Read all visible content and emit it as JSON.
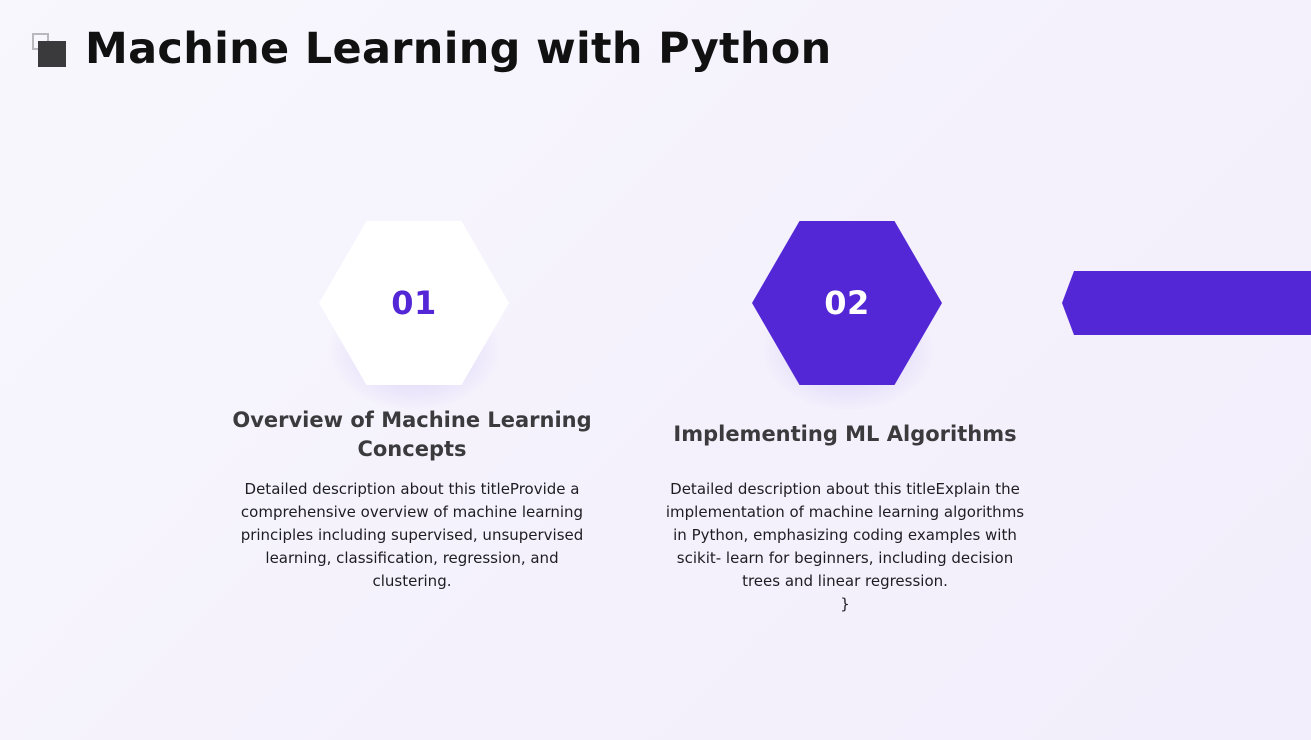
{
  "header": {
    "title": "Machine Learning with Python"
  },
  "items": [
    {
      "number": "01",
      "title_lines": [
        "Overview of Machine Learning",
        "Concepts"
      ],
      "description_lines": [
        "Detailed description about this titleProvide a",
        "comprehensive overview of machine learning",
        "principles including supervised, unsupervised",
        "learning, classification, regression, and",
        "clustering."
      ]
    },
    {
      "number": "02",
      "title_lines": [
        "Implementing ML Algorithms"
      ],
      "description_lines": [
        "Detailed description about this titleExplain the",
        "implementation of machine learning algorithms",
        "in Python, emphasizing coding examples with",
        "scikit- learn for beginners, including decision",
        "trees and linear regression.",
        "}"
      ]
    }
  ],
  "colors": {
    "accent": "#5327d6",
    "title_text": "#111111",
    "heading_text": "#3b3b3e",
    "body_text": "#1e1e22",
    "background": "#f6f4fc"
  },
  "icons": {
    "title": "layered-squares-icon"
  }
}
